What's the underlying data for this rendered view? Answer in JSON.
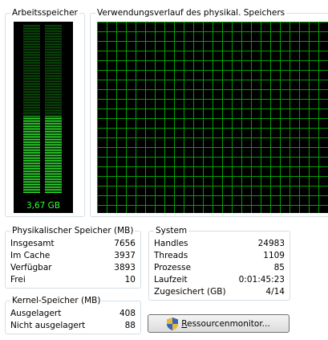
{
  "memory_panel": {
    "title": "Arbeitsspeicher",
    "value_label": "3,67 GB",
    "usage_fraction": 0.46
  },
  "history_panel": {
    "title": "Verwendungsverlauf des physikal. Speichers"
  },
  "physical_memory": {
    "title": "Physikalischer Speicher (MB)",
    "rows": [
      {
        "label": "Insgesamt",
        "value": "7656"
      },
      {
        "label": "Im Cache",
        "value": "3937"
      },
      {
        "label": "Verfügbar",
        "value": "3893"
      },
      {
        "label": "Frei",
        "value": "10"
      }
    ]
  },
  "system": {
    "title": "System",
    "rows": [
      {
        "label": "Handles",
        "value": "24983"
      },
      {
        "label": "Threads",
        "value": "1109"
      },
      {
        "label": "Prozesse",
        "value": "85"
      },
      {
        "label": "Laufzeit",
        "value": "0:01:45:23"
      },
      {
        "label": "Zugesichert (GB)",
        "value": "4/14"
      }
    ]
  },
  "kernel_memory": {
    "title": "Kernel-Speicher (MB)",
    "rows": [
      {
        "label": "Ausgelagert",
        "value": "408"
      },
      {
        "label": "Nicht ausgelagert",
        "value": "88"
      }
    ]
  },
  "resource_monitor_button": {
    "label": "Ressourcenmonitor...",
    "icon": "shield-icon"
  },
  "colors": {
    "meter_green": "#33ff33",
    "meter_dim": "#0b5a0b",
    "grid_green": "#00a000",
    "group_border": "#d5dfe5"
  }
}
